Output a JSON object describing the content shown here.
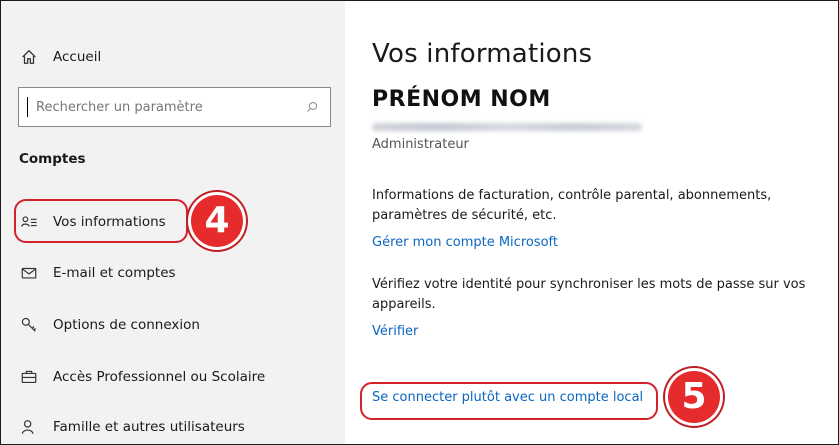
{
  "sidebar": {
    "home_label": "Accueil",
    "search_placeholder": "Rechercher un paramètre",
    "section_title": "Comptes",
    "items": [
      {
        "label": "Vos informations",
        "icon": "user-info-icon"
      },
      {
        "label": "E-mail et comptes",
        "icon": "mail-icon"
      },
      {
        "label": "Options de connexion",
        "icon": "key-icon"
      },
      {
        "label": "Accès Professionnel ou Scolaire",
        "icon": "briefcase-icon"
      },
      {
        "label": "Famille et autres utilisateurs",
        "icon": "person-icon"
      }
    ]
  },
  "main": {
    "title": "Vos informations",
    "user_name": "PRÉNOM NOM",
    "role": "Administrateur",
    "billing_text": "Informations de facturation, contrôle parental, abonnements, paramètres de sécurité, etc.",
    "manage_link": "Gérer mon compte Microsoft",
    "verify_text": "Vérifiez votre identité pour synchroniser les mots de passe sur vos appareils.",
    "verify_link": "Vérifier",
    "local_account_link": "Se connecter plutôt avec un compte local"
  },
  "annotations": {
    "step_4": "4",
    "step_5": "5"
  },
  "colors": {
    "accent_link": "#0b66c2",
    "highlight_red": "#d4222b",
    "badge_red": "#e52b2b",
    "sidebar_bg": "#f2f2f2"
  }
}
